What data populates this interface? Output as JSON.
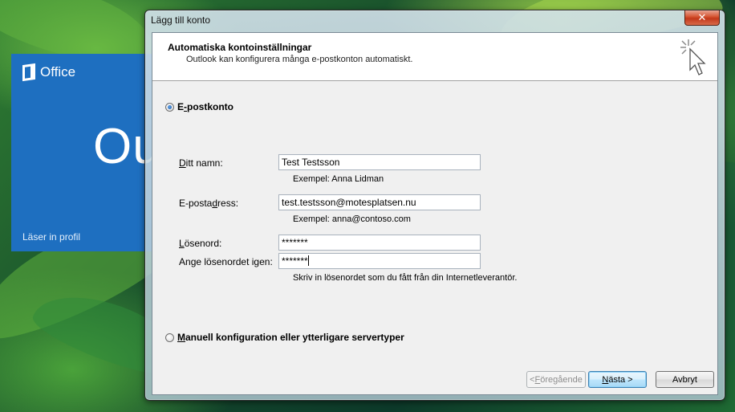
{
  "splash": {
    "brand": "Office",
    "app_fragment": "Ou",
    "status": "Läser in profil",
    "color": "#1e6fc0"
  },
  "dialog": {
    "title": "Lägg till konto",
    "close_icon": "close-icon",
    "header_title": "Automatiska kontoinställningar",
    "header_subtitle": "Outlook kan konfigurera många e-postkonton automatiskt.",
    "header_icon": "wizard-cursor-icon"
  },
  "email_option": {
    "label_pre": "E",
    "label_accel": "-",
    "label_post": "postkonto",
    "selected": true
  },
  "form": {
    "name_label_accel": "D",
    "name_label_rest": "itt namn:",
    "name_value": "Test Testsson",
    "name_hint": "Exempel: Anna Lidman",
    "email_label_pre": "E-posta",
    "email_label_accel": "d",
    "email_label_post": "ress:",
    "email_value": "test.testsson@motesplatsen.nu",
    "email_hint": "Exempel: anna@contoso.com",
    "password_label_accel": "L",
    "password_label_rest": "ösenord:",
    "password_value": "*******",
    "confirm_label_pre": "An",
    "confirm_label_accel": "g",
    "confirm_label_post": "e lösenordet igen:",
    "confirm_value": "*******",
    "password_hint": "Skriv in lösenordet som du fått från din Internetleverantör."
  },
  "manual_option": {
    "label_accel": "M",
    "label_rest": "anuell konfiguration eller ytterligare servertyper",
    "selected": false
  },
  "buttons": {
    "back_pre": "< ",
    "back_accel": "F",
    "back_post": "öregående",
    "next_pre": "",
    "next_accel": "N",
    "next_post": "ästa >",
    "cancel": "Avbryt"
  }
}
